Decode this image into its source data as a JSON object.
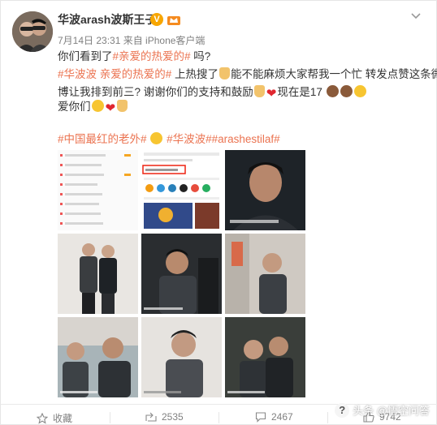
{
  "post": {
    "author": "华波arash波斯王子",
    "verified_badge": "V",
    "meta": "7月14日 23:31 来自 iPhone客户端",
    "line1_text": "你们看到了",
    "line1_tag": "#亲爱的热爱的#",
    "line1_end": " 吗?",
    "line2_tag1": "#华波波 亲爱的热爱的#",
    "line2_text": " 上热搜了",
    "line2_text2": "能不能麻烦大家帮我一个忙 转发点赞这条微",
    "line3_text": "博让我排到前三? 谢谢你们的支持和鼓励",
    "line3_text2": "现在是17",
    "line4_text": "爱你们",
    "hashtags1": "#中国最红的老外#",
    "hashtags2": "#华波波##arashestilaf#"
  },
  "thumbs": {
    "first_screenshot_label": "华波波 亲爱的热爱的",
    "caption": "微博@华波arash波斯王子",
    "subtitle": "不过"
  },
  "actions": {
    "favorite": "收藏",
    "share_count": "2535",
    "comment_count": "2467",
    "like_count": "9742"
  },
  "watermark": "头条 @悟空问答",
  "colors": {
    "accent_link": "#eb7350",
    "verified": "#f7a600"
  }
}
